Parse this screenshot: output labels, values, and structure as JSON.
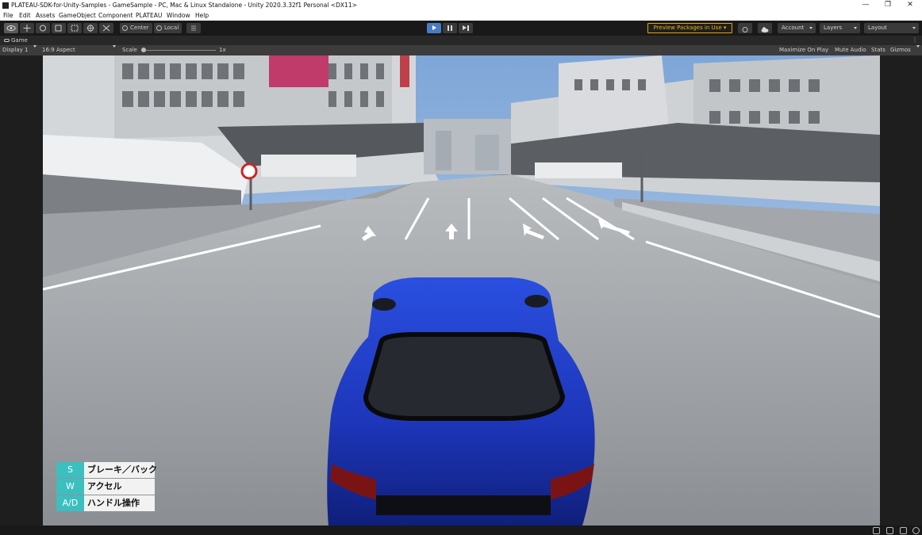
{
  "window": {
    "title": "PLATEAU-SDK-for-Unity-Samples - GameSample - PC, Mac & Linux Standalone - Unity 2020.3.32f1 Personal <DX11>",
    "controls": {
      "minimize": "—",
      "maximize": "❐",
      "close": "✕"
    }
  },
  "menu": {
    "items": [
      "File",
      "Edit",
      "Assets",
      "GameObject",
      "Component",
      "PLATEAU",
      "Window",
      "Help"
    ]
  },
  "toolbar": {
    "tools": [
      "view-tool",
      "move-tool",
      "rotate-tool",
      "scale-tool",
      "rect-tool",
      "transform-tool",
      "custom-tool"
    ],
    "pivot_label": "Center",
    "space_label": "Local",
    "preview_packages": "Preview Packages in Use ▾",
    "account": "Account",
    "layers": "Layers",
    "layout": "Layout",
    "play_active": true
  },
  "game_tab": {
    "label": "Game"
  },
  "game_view": {
    "display": "Display 1",
    "aspect": "16:9 Aspect",
    "scale_label": "Scale",
    "scale_value": "1x",
    "maximize": "Maximize On Play",
    "mute": "Mute Audio",
    "stats": "Stats",
    "gizmos": "Gizmos"
  },
  "legend": [
    {
      "key": "S",
      "label": "ブレーキ／バック"
    },
    {
      "key": "W",
      "label": "アクセル"
    },
    {
      "key": "A/D",
      "label": "ハンドル操作"
    }
  ],
  "colors": {
    "accent": "#3cbfbf",
    "play_button": "#4a7cc2",
    "preview_border": "#e8a700",
    "car_body": "#1f3fcf"
  }
}
